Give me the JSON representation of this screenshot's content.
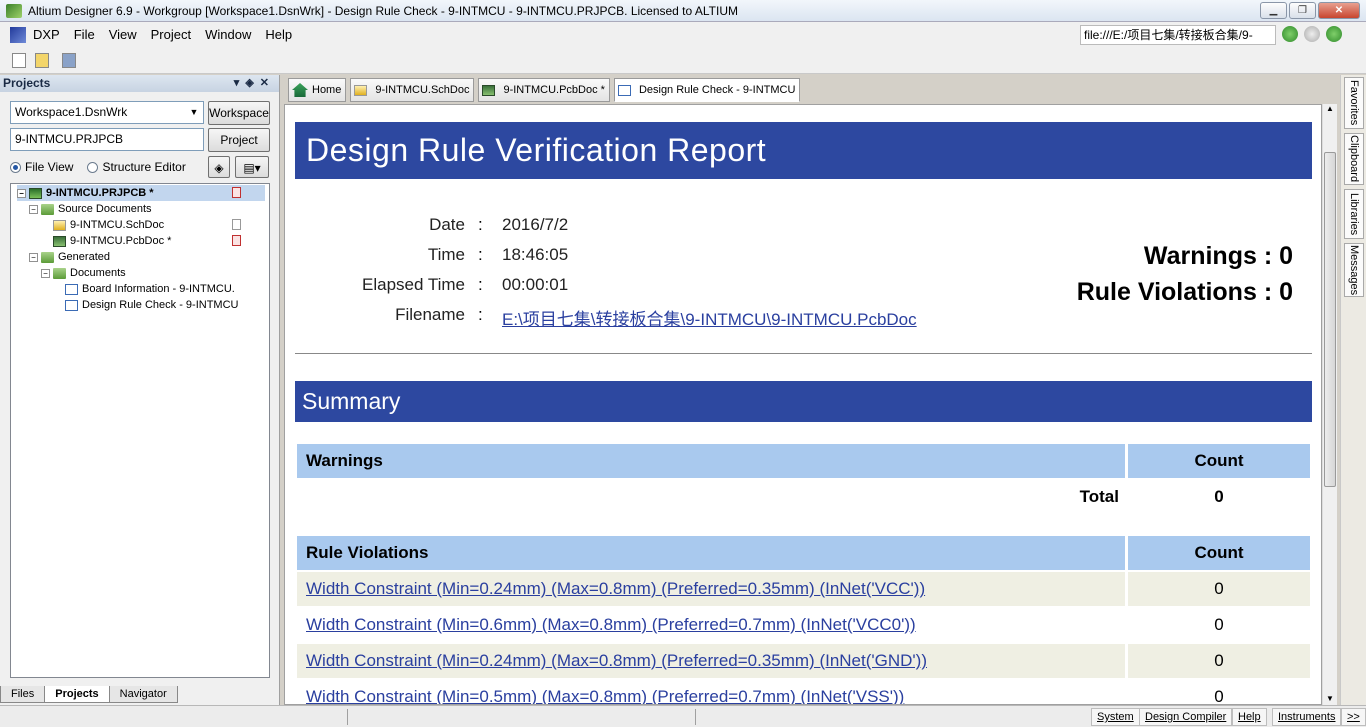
{
  "window": {
    "title": "Altium Designer 6.9 - Workgroup [Workspace1.DsnWrk] - Design Rule Check - 9-INTMCU - 9-INTMCU.PRJPCB. Licensed to ALTIUM"
  },
  "menu": {
    "items": [
      "DXP",
      "File",
      "View",
      "Project",
      "Window",
      "Help"
    ]
  },
  "address": {
    "value": "file:///E:/项目七集/转接板合集/9-"
  },
  "projects_panel": {
    "title": "Projects",
    "workspace_value": "Workspace1.DsnWrk",
    "workspace_button": "Workspace",
    "project_value": "9-INTMCU.PRJPCB",
    "project_button": "Project",
    "radio_fileview": "File View",
    "radio_structure": "Structure Editor",
    "tree": [
      {
        "label": "9-INTMCU.PRJPCB *"
      },
      {
        "label": "Source Documents"
      },
      {
        "label": "9-INTMCU.SchDoc"
      },
      {
        "label": "9-INTMCU.PcbDoc *"
      },
      {
        "label": "Generated"
      },
      {
        "label": "Documents"
      },
      {
        "label": "Board Information - 9-INTMCU."
      },
      {
        "label": "Design Rule Check - 9-INTMCU"
      }
    ],
    "bottom_tabs": [
      "Files",
      "Projects",
      "Navigator"
    ]
  },
  "doc_tabs": [
    "Home",
    "9-INTMCU.SchDoc",
    "9-INTMCU.PcbDoc *",
    "Design Rule Check - 9-INTMCU"
  ],
  "report": {
    "title": "Design Rule Verification Report",
    "date_label": "Date",
    "date": "2016/7/2",
    "time_label": "Time",
    "time": "18:46:05",
    "elapsed_label": "Elapsed Time",
    "elapsed": "00:00:01",
    "filename_label": "Filename",
    "filename": "E:\\项目七集\\转接板合集\\9-INTMCU\\9-INTMCU.PcbDoc",
    "colon": ":",
    "warnings_label": "Warnings",
    "warnings_value": "0",
    "violations_label": "Rule Violations",
    "violations_value": "0",
    "summary_title": "Summary",
    "warnings_table": {
      "header": "Warnings",
      "count_header": "Count",
      "total_label": "Total",
      "total": "0"
    },
    "violations_table": {
      "header": "Rule Violations",
      "count_header": "Count",
      "rows": [
        {
          "rule": "Width Constraint (Min=0.24mm) (Max=0.8mm) (Preferred=0.35mm) (InNet('VCC'))",
          "count": "0"
        },
        {
          "rule": "Width Constraint (Min=0.6mm) (Max=0.8mm) (Preferred=0.7mm) (InNet('VCC0'))",
          "count": "0"
        },
        {
          "rule": "Width Constraint (Min=0.24mm) (Max=0.8mm) (Preferred=0.35mm) (InNet('GND'))",
          "count": "0"
        },
        {
          "rule": "Width Constraint (Min=0.5mm) (Max=0.8mm) (Preferred=0.7mm) (InNet('VSS'))",
          "count": "0"
        }
      ]
    }
  },
  "right_panels": [
    "Favorites",
    "Clipboard",
    "Libraries",
    "Messages"
  ],
  "status_bar": {
    "buttons": [
      "System",
      "Design Compiler",
      "Help",
      "Instruments",
      ">>"
    ]
  }
}
